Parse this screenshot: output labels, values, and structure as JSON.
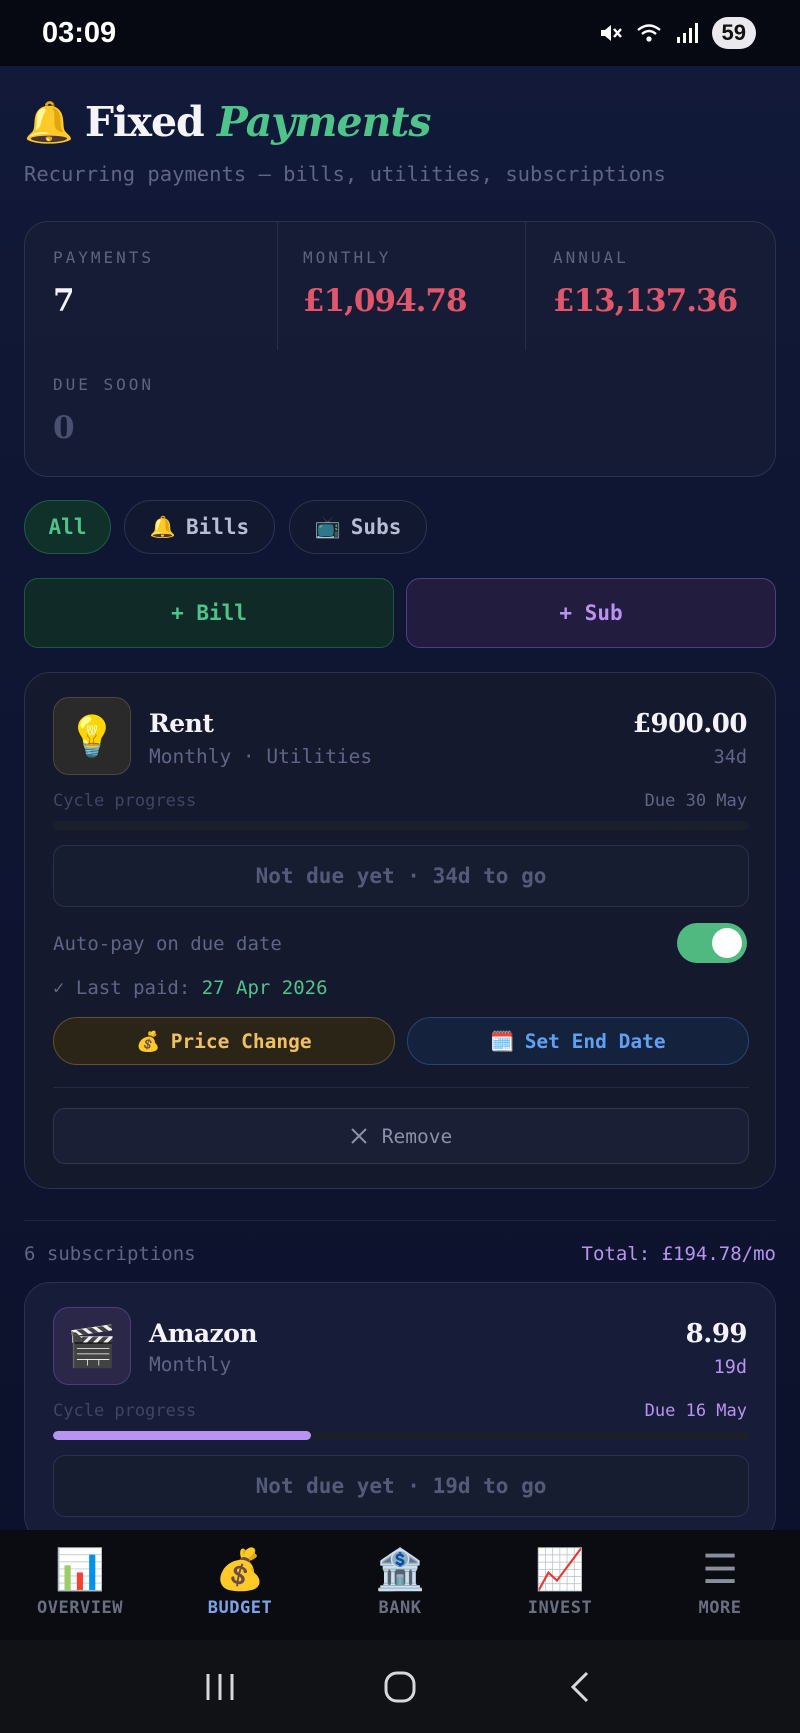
{
  "status_bar": {
    "time": "03:09",
    "battery": "59"
  },
  "header": {
    "bell_emoji": "🔔",
    "title_main": "Fixed",
    "title_accent": "Payments",
    "subtitle": "Recurring payments — bills, utilities, subscriptions"
  },
  "summary": {
    "payments_label": "PAYMENTS",
    "payments_value": "7",
    "monthly_label": "MONTHLY",
    "monthly_value": "£1,094.78",
    "annual_label": "ANNUAL",
    "annual_value": "£13,137.36",
    "due_soon_label": "DUE SOON",
    "due_soon_value": "0",
    "colors": {
      "negative": "#e0566a",
      "neutral": "#f4f4f8",
      "muted": "#4a5070"
    }
  },
  "filters": [
    {
      "label": "All",
      "emoji": "",
      "active": true
    },
    {
      "label": "Bills",
      "emoji": "🔔",
      "active": false
    },
    {
      "label": "Subs",
      "emoji": "📺",
      "active": false
    }
  ],
  "add_buttons": {
    "bill": "+ Bill",
    "sub": "+ Sub"
  },
  "rent": {
    "icon": "💡",
    "name": "Rent",
    "meta": "Monthly · Utilities",
    "amount": "£900.00",
    "days": "34d",
    "cycle_label": "Cycle progress",
    "due": "Due 30 May",
    "progress": 0,
    "not_due": "Not due yet · 34d to go",
    "autopay_label": "Auto-pay on due date",
    "autopay_on": true,
    "last_paid_prefix": "✓ Last paid:",
    "last_paid_date": "27 Apr 2026",
    "price_change": "Price Change",
    "price_change_emoji": "💰",
    "set_end_date": "Set End Date",
    "set_end_date_emoji": "🗓️",
    "remove": "Remove"
  },
  "subscriptions": {
    "count": "6 subscriptions",
    "total": "Total: £194.78/mo"
  },
  "amazon": {
    "icon": "🎬",
    "name": "Amazon",
    "meta": "Monthly",
    "amount": "8.99",
    "days": "19d",
    "cycle_label": "Cycle progress",
    "due": "Due 16 May",
    "progress": 0.37,
    "not_due": "Not due yet · 19d to go",
    "accent": "#b993f2"
  },
  "nav": [
    {
      "label": "OVERVIEW",
      "icon": "📊",
      "active": false,
      "name": "nav-overview"
    },
    {
      "label": "BUDGET",
      "icon": "💰",
      "active": true,
      "name": "nav-budget"
    },
    {
      "label": "BANK",
      "icon": "🏦",
      "active": false,
      "name": "nav-bank"
    },
    {
      "label": "INVEST",
      "icon": "📈",
      "active": false,
      "name": "nav-invest"
    },
    {
      "label": "MORE",
      "icon": "☰",
      "active": false,
      "name": "nav-more"
    }
  ]
}
